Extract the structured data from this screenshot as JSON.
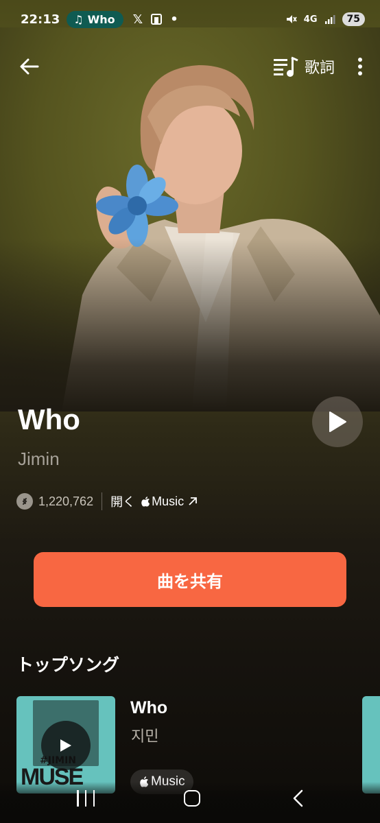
{
  "status_bar": {
    "time": "22:13",
    "now_playing": "Who",
    "network": "4G",
    "battery": "75"
  },
  "top_nav": {
    "lyrics_label": "歌詞"
  },
  "song": {
    "title": "Who",
    "artist": "Jimin",
    "shazam_count": "1,220,762",
    "open_label": "開く",
    "apple_music_label": "Music"
  },
  "share_button_label": "曲を共有",
  "top_songs": {
    "section_title": "トップソング",
    "items": [
      {
        "title": "Who",
        "artist": "지민",
        "badge": "Music",
        "art_text_top": "#JIMIN",
        "art_text_bottom": "MUSE"
      }
    ]
  },
  "colors": {
    "accent": "#f86742",
    "pill": "#0f5b52",
    "card_art": "#66c2bd"
  }
}
